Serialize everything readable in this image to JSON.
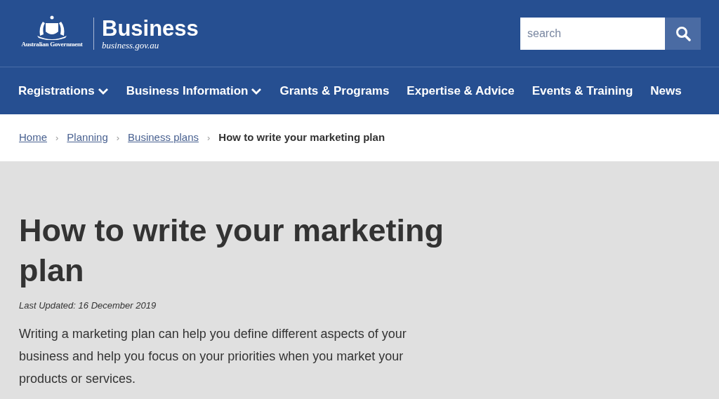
{
  "header": {
    "logo_caption": "Australian Government",
    "site_name": "Business",
    "site_url": "business.gov.au",
    "search": {
      "placeholder": "search"
    }
  },
  "nav": [
    {
      "label": "Registrations",
      "kind": "dropdown"
    },
    {
      "label": "Business Information",
      "kind": "dropdown"
    },
    {
      "label": "Grants & Programs",
      "kind": "link"
    },
    {
      "label": "Expertise & Advice",
      "kind": "link"
    },
    {
      "label": "Events & Training",
      "kind": "link"
    },
    {
      "label": "News",
      "kind": "link"
    }
  ],
  "breadcrumb": {
    "separator": "›",
    "items": [
      {
        "label": "Home",
        "kind": "link"
      },
      {
        "label": "Planning",
        "kind": "link"
      },
      {
        "label": "Business plans",
        "kind": "link"
      },
      {
        "label": "How to write your marketing plan",
        "kind": "current"
      }
    ]
  },
  "article": {
    "title": "How to write your marketing plan",
    "updated": "Last Updated: 16 December 2019",
    "intro": "Writing a marketing plan can help you define different aspects of your business and help you focus on your priorities when you market your products or services."
  }
}
